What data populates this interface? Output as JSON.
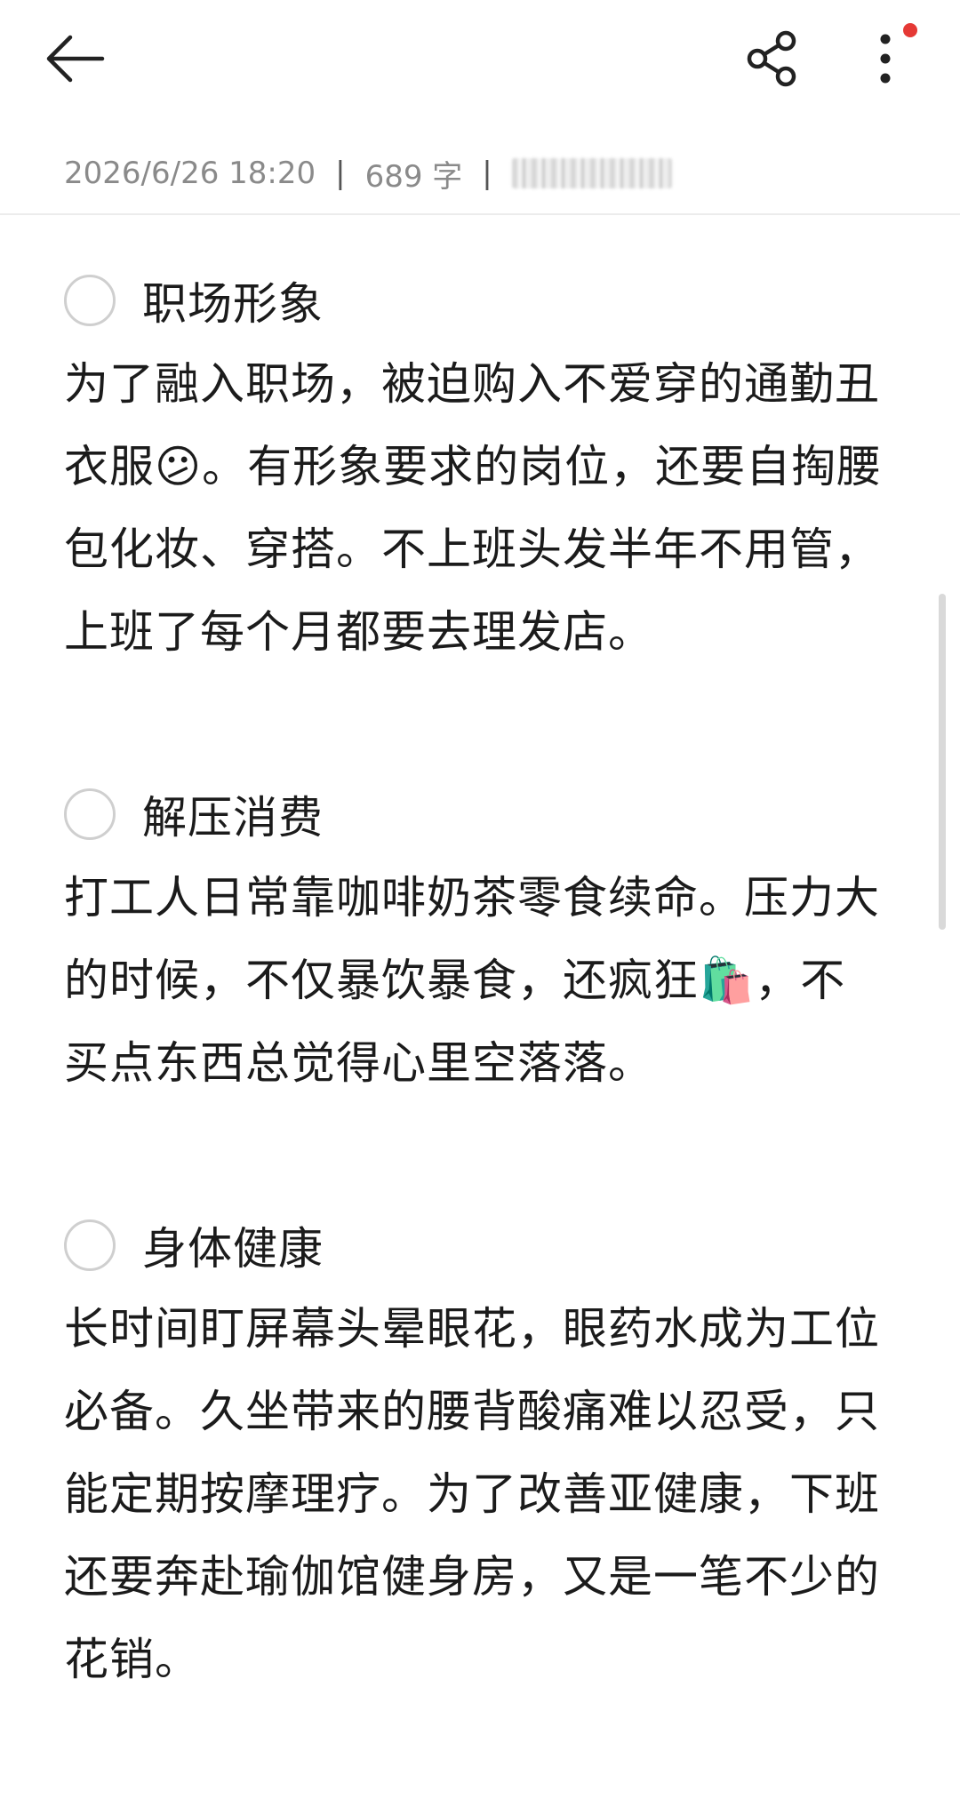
{
  "meta": {
    "datetime": "2026/6/26 18:20",
    "separator": "|",
    "word_count": "689 字"
  },
  "icons": {
    "back": "arrow-left-icon",
    "share": "share-icon",
    "more": "more-vertical-icon",
    "notify_color": "#e53935"
  },
  "sections": [
    {
      "title": "职场形象",
      "body": "为了融入职场，被迫购入不爱穿的通勤丑衣服😕。有形象要求的岗位，还要自掏腰包化妆、穿搭。不上班头发半年不用管，上班了每个月都要去理发店。"
    },
    {
      "title": "解压消费",
      "body": "打工人日常靠咖啡奶茶零食续命。压力大的时候，不仅暴饮暴食，还疯狂🛍️，不买点东西总觉得心里空落落。"
    },
    {
      "title": "身体健康",
      "body": "长时间盯屏幕头晕眼花，眼药水成为工位必备。久坐带来的腰背酸痛难以忍受，只能定期按摩理疗。为了改善亚健康，下班还要奔赴瑜伽馆健身房，又是一笔不少的花销。"
    }
  ]
}
